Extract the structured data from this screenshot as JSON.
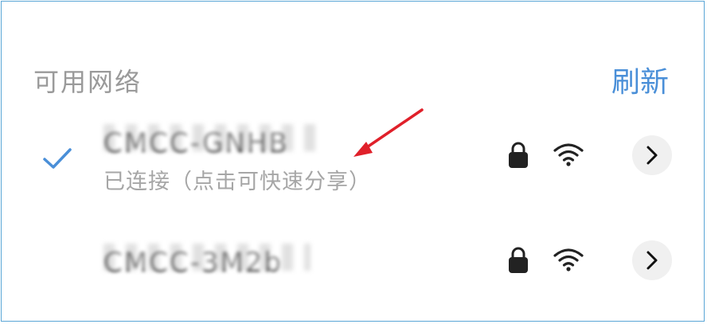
{
  "header": {
    "title": "可用网络",
    "refresh_label": "刷新"
  },
  "networks": [
    {
      "ssid": "CMCC-GNHB",
      "status": "已连接（点击可快速分享）",
      "connected": true,
      "secured": true,
      "icons": [
        "check-icon",
        "lock-icon",
        "wifi-icon",
        "chevron-right-icon"
      ]
    },
    {
      "ssid": "CMCC-3M2b",
      "secured": true,
      "icons": [
        "lock-icon",
        "wifi-icon",
        "chevron-right-icon"
      ]
    }
  ],
  "colors": {
    "accent": "#4a8fd8",
    "annotation_arrow": "#e0202a",
    "muted_text": "#9a9a9a"
  }
}
